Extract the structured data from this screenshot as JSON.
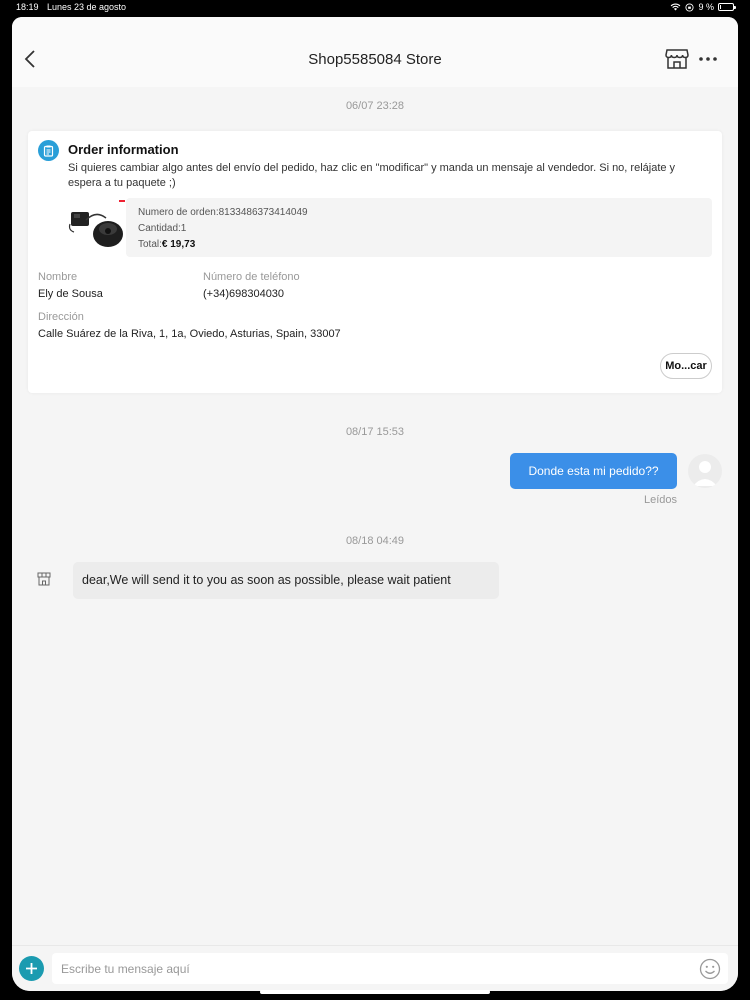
{
  "status_bar": {
    "time": "18:19",
    "date": "Lunes 23 de agosto",
    "battery": "9 %",
    "battery_level": 0.09
  },
  "header": {
    "title": "Shop5585084 Store",
    "back_icon": "chevron-left-icon",
    "store_icon": "store-icon",
    "more_icon": "more-horizontal-icon"
  },
  "messages": {
    "timestamp_1": "06/07 23:28",
    "timestamp_2": "08/17 15:53",
    "timestamp_3": "08/18 04:49",
    "outgoing_text": "Donde esta mi pedido??",
    "read_status": "Leídos",
    "incoming_text": "dear,We will send it to you as soon as possible, please wait patient"
  },
  "order": {
    "title": "Order information",
    "description": "Si quieres cambiar algo antes del envío del pedido, haz clic en \"modificar\" y manda un mensaje al vendedor.  Si no, relájate y espera a tu paquete ;)",
    "order_number": "Numero de orden:8133486373414049",
    "quantity": "Cantidad:1",
    "total_label": "Total:",
    "total_value": "€ 19,73",
    "name_label": "Nombre",
    "name_value": "Ely de Sousa",
    "phone_label": "Número de teléfono",
    "phone_value": "(+34)698304030",
    "address_label": "Dirección",
    "address_value": "Calle Suárez de la Riva, 1, 1a, Oviedo, Asturias, Spain, 33007",
    "modify_button": "Mo...car"
  },
  "input": {
    "placeholder": "Escribe tu mensaje aquí"
  },
  "colors": {
    "accent_blue": "#3b8fe8",
    "info_icon_blue": "#2a9fd8",
    "plus_teal": "#1b9bb0"
  }
}
